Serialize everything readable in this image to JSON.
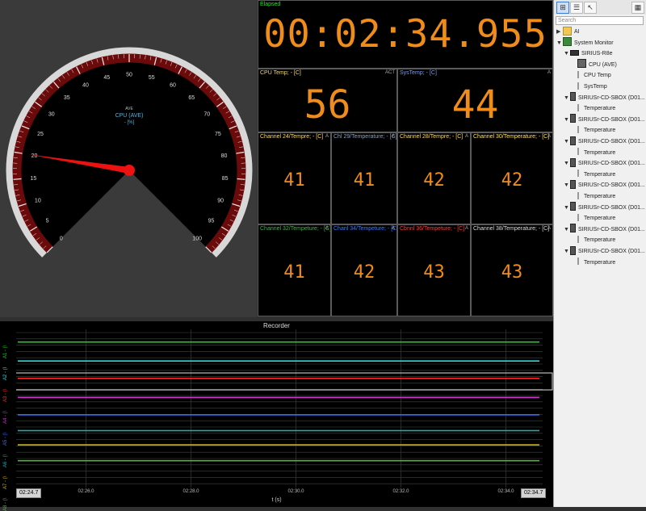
{
  "gauge": {
    "ticks": [
      "0",
      "5",
      "10",
      "15",
      "20",
      "25",
      "30",
      "35",
      "40",
      "45",
      "50",
      "55",
      "60",
      "65",
      "70",
      "75",
      "80",
      "85",
      "90",
      "95",
      "100"
    ],
    "caption_small": "AVE",
    "caption_channel": "CPU (AVE)",
    "caption_unit": "- [%]",
    "value": 20,
    "range": [
      0,
      100
    ]
  },
  "elapsed": {
    "title": "Elapsed",
    "value": "00:02:34.955"
  },
  "big_panels": [
    {
      "title": "CPU Temp; - [C]",
      "flag": "ACT",
      "value": "56",
      "color": "#ffd966"
    },
    {
      "title": "SysTemp; - [C]",
      "flag": "A",
      "value": "44",
      "color": "#7b9cff"
    }
  ],
  "small_panels": [
    {
      "title": "Channel 24/Tempre; - [C]",
      "flag": "A",
      "value": "41",
      "color": "#ffd966"
    },
    {
      "title": "Chl 29/Temperature; - [C]",
      "flag": "A",
      "value": "41",
      "color": "#8fa0b8"
    },
    {
      "title": "Channel 28/Tempre; - [C]",
      "flag": "A",
      "value": "42",
      "color": "#ffd966"
    },
    {
      "title": "Channel 30/Temperature; - [C]",
      "flag": "A",
      "value": "42",
      "color": "#ffe066"
    },
    {
      "title": "Channel 32/Tempeture; - [C]",
      "flag": "A",
      "value": "41",
      "color": "#4caf50"
    },
    {
      "title": "Chanl 34/Tempeture; - [C]",
      "flag": "A",
      "value": "42",
      "color": "#3a7bff"
    },
    {
      "title": "Cbnnl 36/Tempeture; - [C]",
      "flag": "A",
      "value": "43",
      "color": "#ff3b3b"
    },
    {
      "title": "Channel 38/Temperature; - [C]",
      "flag": "A",
      "value": "43",
      "color": "#dddddd"
    }
  ],
  "tree": {
    "search_placeholder": "Search",
    "items": [
      {
        "label": "AI",
        "level": 0,
        "arrow": "▶",
        "icon": "folder-icon"
      },
      {
        "label": "System Monitor",
        "level": 0,
        "arrow": "▼",
        "icon": "monitor-icon"
      },
      {
        "label": "SIRIUS-R8e",
        "level": 1,
        "arrow": "▼",
        "icon": "device-icon"
      },
      {
        "label": "CPU (AVE)",
        "level": 2,
        "arrow": "",
        "icon": "cpu-icon"
      },
      {
        "label": "CPU Temp",
        "level": 2,
        "arrow": "",
        "icon": "thermometer-icon"
      },
      {
        "label": "SysTemp",
        "level": 2,
        "arrow": "",
        "icon": "thermometer-icon"
      },
      {
        "label": "SIRIUSr-CD-SBOX (D01...",
        "level": 1,
        "arrow": "▼",
        "icon": "sbox-icon"
      },
      {
        "label": "Temperature",
        "level": 2,
        "arrow": "",
        "icon": "thermometer-icon"
      },
      {
        "label": "SIRIUSr-CD-SBOX (D01...",
        "level": 1,
        "arrow": "▼",
        "icon": "sbox-icon"
      },
      {
        "label": "Temperature",
        "level": 2,
        "arrow": "",
        "icon": "thermometer-icon"
      },
      {
        "label": "SIRIUSr-CD-SBOX (D01...",
        "level": 1,
        "arrow": "▼",
        "icon": "sbox-icon"
      },
      {
        "label": "Temperature",
        "level": 2,
        "arrow": "",
        "icon": "thermometer-icon"
      },
      {
        "label": "SIRIUSr-CD-SBOX (D01...",
        "level": 1,
        "arrow": "▼",
        "icon": "sbox-icon"
      },
      {
        "label": "Temperature",
        "level": 2,
        "arrow": "",
        "icon": "thermometer-icon"
      },
      {
        "label": "SIRIUSr-CD-SBOX (D01...",
        "level": 1,
        "arrow": "▼",
        "icon": "sbox-icon"
      },
      {
        "label": "Temperature",
        "level": 2,
        "arrow": "",
        "icon": "thermometer-icon"
      },
      {
        "label": "SIRIUSr-CD-SBOX (D01...",
        "level": 1,
        "arrow": "▼",
        "icon": "sbox-icon"
      },
      {
        "label": "Temperature",
        "level": 2,
        "arrow": "",
        "icon": "thermometer-icon"
      },
      {
        "label": "SIRIUSr-CD-SBOX (D01...",
        "level": 1,
        "arrow": "▼",
        "icon": "sbox-icon"
      },
      {
        "label": "Temperature",
        "level": 2,
        "arrow": "",
        "icon": "thermometer-icon"
      },
      {
        "label": "SIRIUSr-CD-SBOX (D01...",
        "level": 1,
        "arrow": "▼",
        "icon": "sbox-icon"
      },
      {
        "label": "Temperature",
        "level": 2,
        "arrow": "",
        "icon": "thermometer-icon"
      }
    ]
  },
  "recorder": {
    "title": "Recorder",
    "x_label": "t (s)",
    "start_time": "02:24.7",
    "end_time": "02:34.7",
    "x_ticks": [
      "02:26.0",
      "02:28.0",
      "02:30.0",
      "02:32.0",
      "02:34.0"
    ],
    "x_tick_values": [
      26.0,
      28.0,
      30.0,
      32.0,
      34.0
    ],
    "x_range": [
      24.7,
      34.7
    ],
    "track_labels": [
      "A1 - (\\",
      "A2 - (I",
      "A3 - (\\",
      "A4 - (\\",
      "A5 - (\\",
      "A6 - (\\",
      "A7 - (\\",
      "A8 - (\\"
    ],
    "axis_ticks": [
      "0",
      "10"
    ],
    "traces": [
      {
        "color": "#22cc22",
        "level": 0.92
      },
      {
        "color": "#22dddd",
        "level": 0.8
      },
      {
        "color": "#ff2a2a",
        "level": 0.69
      },
      {
        "color": "#cc33cc",
        "level": 0.57
      },
      {
        "color": "#3a6bff",
        "level": 0.46
      },
      {
        "color": "#2aa8a8",
        "level": 0.36
      },
      {
        "color": "#c8b020",
        "level": 0.27
      },
      {
        "color": "#6ca060",
        "level": 0.17
      }
    ]
  }
}
